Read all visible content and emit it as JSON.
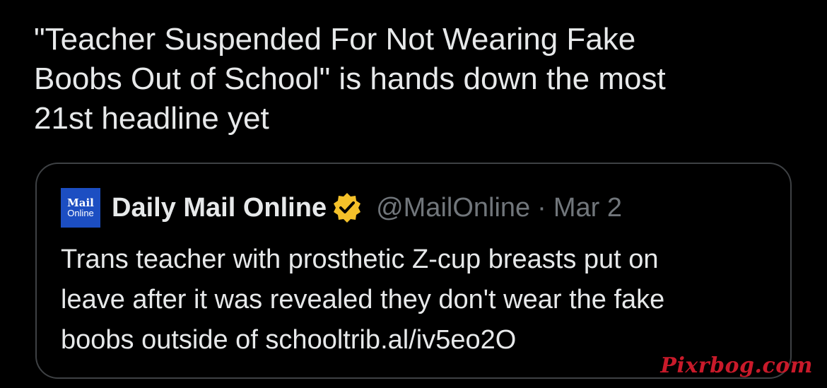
{
  "tweet": {
    "text": "\"Teacher Suspended For Not Wearing Fake\nBoobs Out of School\" is hands down the most\n21st headline yet"
  },
  "quote": {
    "avatar": {
      "logo_top": "Mail",
      "logo_bottom": "Online",
      "color": "#1c4ec2"
    },
    "author_name": "Daily Mail Online",
    "verified_icon": "verified-badge-gold",
    "verified_color": "#f4c12a",
    "handle": "@MailOnline",
    "separator": "·",
    "date": "Mar 2",
    "text": "Trans teacher with prosthetic Z-cup breasts put on\nleave after it was revealed they don't wear the fake\nboobs outside of schooltrib.al/iv5eo2O"
  },
  "watermark": {
    "text": "Pixrbog.com",
    "color": "#c91a2a"
  },
  "colors": {
    "background": "#000000",
    "text_primary": "#e7e9ea",
    "text_secondary": "#71767b",
    "border": "#3e4144"
  }
}
